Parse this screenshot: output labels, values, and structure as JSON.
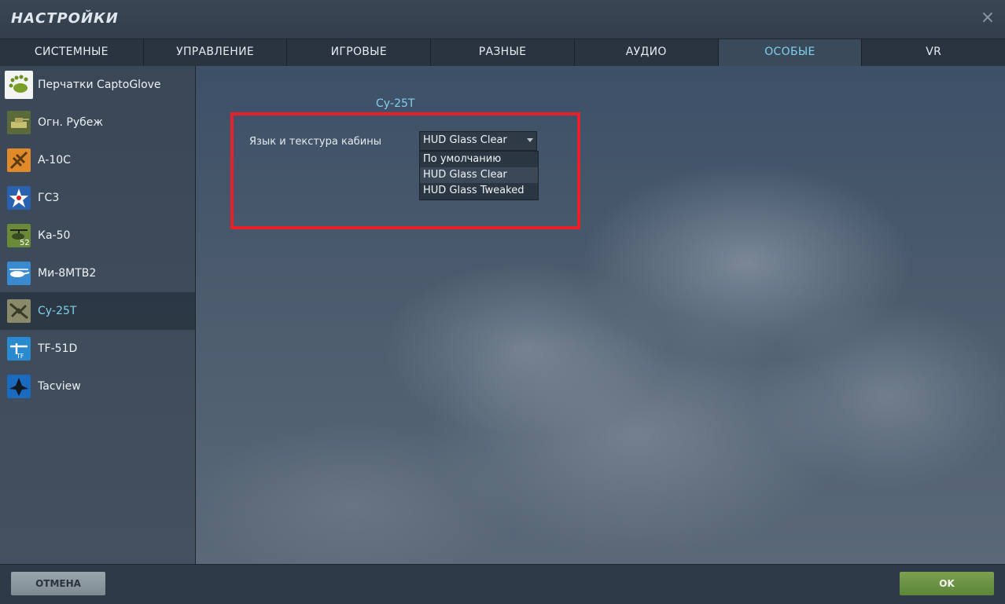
{
  "window": {
    "title": "НАСТРОЙКИ",
    "close_symbol": "×"
  },
  "tabs": [
    {
      "label": "СИСТЕМНЫЕ"
    },
    {
      "label": "УПРАВЛЕНИЕ"
    },
    {
      "label": "ИГРОВЫЕ"
    },
    {
      "label": "РАЗНЫЕ"
    },
    {
      "label": "АУДИО"
    },
    {
      "label": "ОСОБЫЕ",
      "active": true
    },
    {
      "label": "VR"
    }
  ],
  "sidebar": {
    "items": [
      {
        "label": "Перчатки CaptoGlove",
        "icon": "captoglove-icon"
      },
      {
        "label": "Огн. Рубеж",
        "icon": "combined-arms-icon"
      },
      {
        "label": "A-10C",
        "icon": "a10c-icon"
      },
      {
        "label": "ГС3",
        "icon": "star-icon"
      },
      {
        "label": "Ка-50",
        "icon": "ka50-icon"
      },
      {
        "label": "Ми-8МТВ2",
        "icon": "mi8-icon"
      },
      {
        "label": "Су-25Т",
        "icon": "su25t-icon",
        "active": true
      },
      {
        "label": "TF-51D",
        "icon": "tf51d-icon"
      },
      {
        "label": "Tacview",
        "icon": "tacview-icon"
      }
    ]
  },
  "main": {
    "section_title": "Су-25Т",
    "field_label": "Язык и текстура кабины",
    "select_value": "HUD Glass Clear",
    "options": [
      {
        "label": "По умолчанию"
      },
      {
        "label": "HUD Glass Clear",
        "selected": true
      },
      {
        "label": "HUD Glass Tweaked"
      }
    ]
  },
  "footer": {
    "cancel_label": "ОТМЕНА",
    "ok_label": "OK"
  },
  "colors": {
    "accent": "#7fd0ee",
    "highlight": "#e8202a",
    "ok": "#6a9444",
    "cancel": "#8c98a0"
  }
}
